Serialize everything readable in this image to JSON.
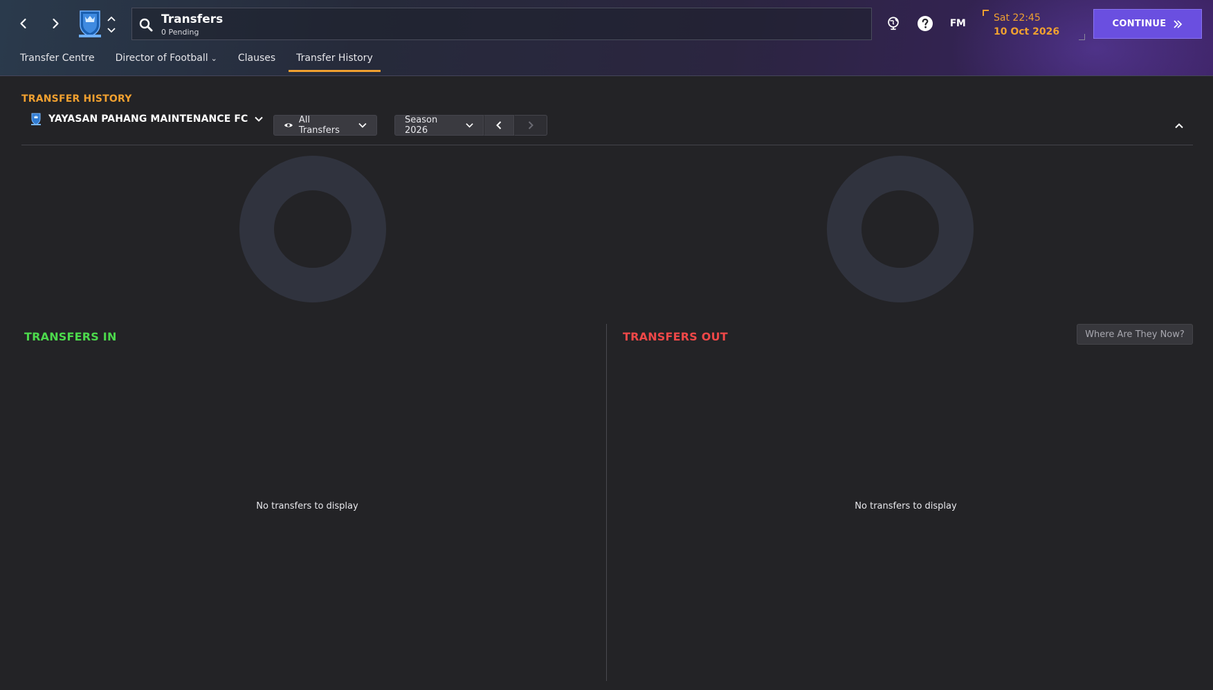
{
  "header": {
    "search": {
      "title": "Transfers",
      "subtitle": "0 Pending"
    },
    "datetime": {
      "time": "Sat 22:45",
      "date": "10 Oct 2026"
    },
    "continue_label": "CONTINUE",
    "fm_logo": "FM",
    "colors": {
      "accent": "#f0a030",
      "continue": "#6a4fe0"
    }
  },
  "tabs": [
    {
      "label": "Transfer Centre",
      "has_dropdown": false,
      "active": false
    },
    {
      "label": "Director of Football",
      "has_dropdown": true,
      "active": false
    },
    {
      "label": "Clauses",
      "has_dropdown": false,
      "active": false
    },
    {
      "label": "Transfer History",
      "has_dropdown": false,
      "active": true
    }
  ],
  "main": {
    "section_title": "TRANSFER HISTORY",
    "club_name": "YAYASAN PAHANG MAINTENANCE FC",
    "filter_label": "All Transfers",
    "season_label": "Season 2026",
    "transfers_in": {
      "title": "TRANSFERS IN",
      "empty_message": "No transfers to display",
      "color": "#4cd94c"
    },
    "transfers_out": {
      "title": "TRANSFERS OUT",
      "empty_message": "No transfers to display",
      "color": "#f04848"
    },
    "where_button_label": "Where Are They Now?"
  },
  "icons": {
    "back": "chevron-left-icon",
    "forward": "chevron-right-icon",
    "search": "search-icon",
    "globe": "globe-icon",
    "help": "help-icon",
    "eye": "eye-icon",
    "collapse": "chevron-up-icon"
  }
}
